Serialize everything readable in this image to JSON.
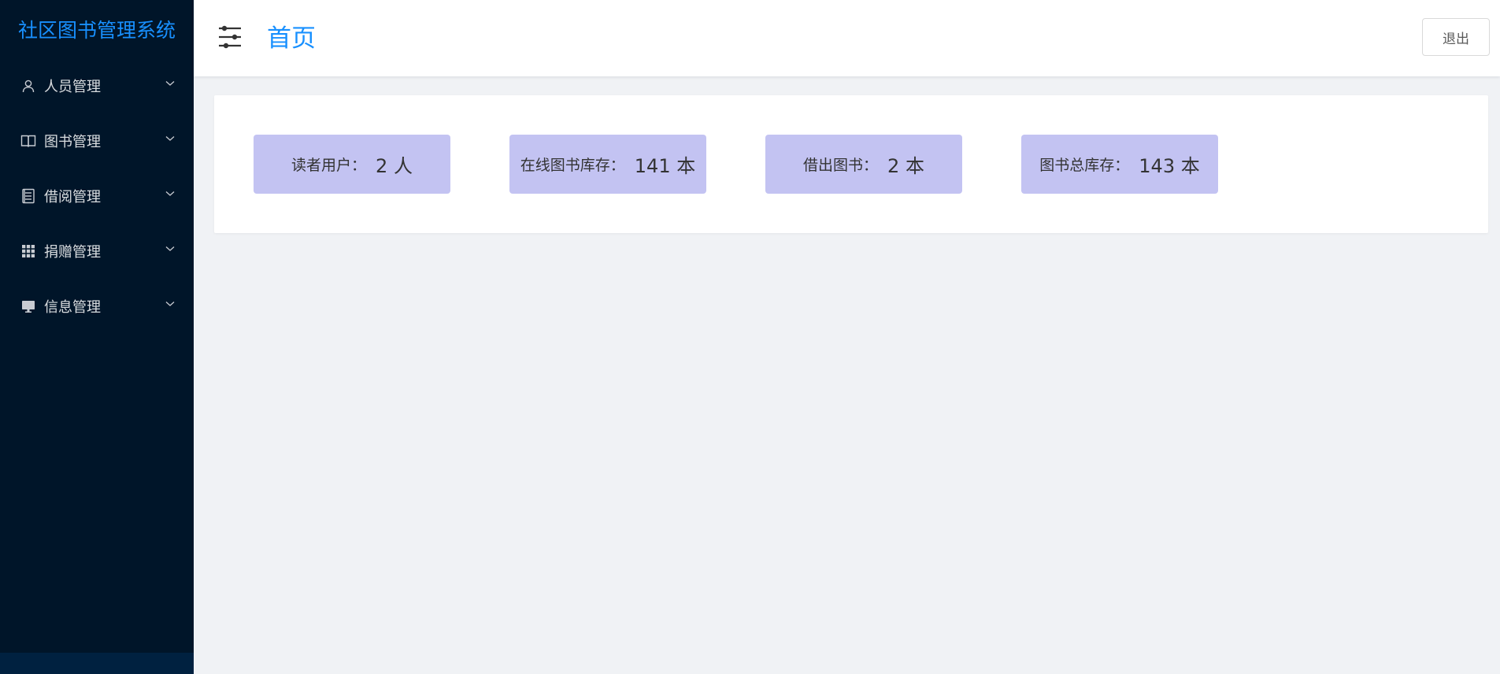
{
  "sidebar": {
    "title": "社区图书管理系统",
    "items": [
      {
        "label": "人员管理",
        "icon": "user-icon"
      },
      {
        "label": "图书管理",
        "icon": "book-icon"
      },
      {
        "label": "借阅管理",
        "icon": "document-icon"
      },
      {
        "label": "捐赠管理",
        "icon": "grid-icon"
      },
      {
        "label": "信息管理",
        "icon": "monitor-icon"
      }
    ]
  },
  "header": {
    "title": "首页",
    "logout_label": "退出"
  },
  "stats": [
    {
      "label": "读者用户：",
      "value": "2 人"
    },
    {
      "label": "在线图书库存：",
      "value": "141 本"
    },
    {
      "label": "借出图书：",
      "value": "2 本"
    },
    {
      "label": "图书总库存：",
      "value": "143 本"
    }
  ],
  "colors": {
    "sidebar_bg": "#001529",
    "accent": "#1890ff",
    "stat_bg": "#c3c3f2",
    "content_bg": "#f0f2f5"
  }
}
